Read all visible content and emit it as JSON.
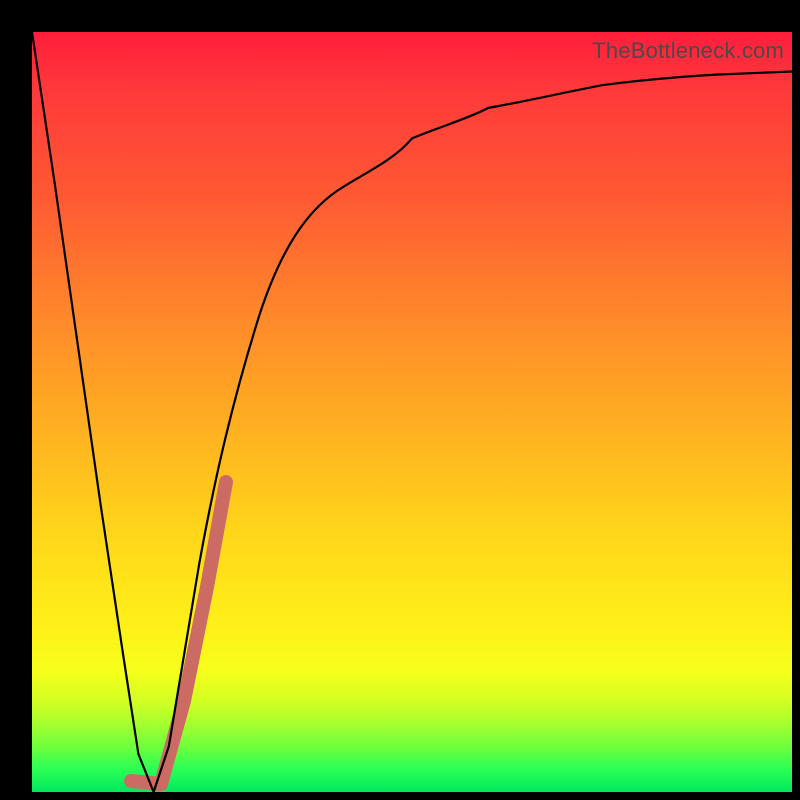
{
  "watermark": "TheBottleneck.com",
  "colors": {
    "gradient_top": "#ff1e3c",
    "gradient_mid": "#ffd61a",
    "gradient_bottom": "#00e85e",
    "curve": "#000000",
    "highlight": "#cc6b63",
    "frame": "#000000"
  },
  "chart_data": {
    "type": "line",
    "title": "",
    "xlabel": "",
    "ylabel": "",
    "xlim": [
      0,
      100
    ],
    "ylim": [
      0,
      100
    ],
    "grid": false,
    "legend": null,
    "series": [
      {
        "name": "bottleneck-curve",
        "x": [
          0,
          3,
          6,
          9,
          12,
          14,
          16,
          18,
          20,
          22,
          25,
          30,
          35,
          40,
          45,
          50,
          55,
          60,
          65,
          70,
          75,
          80,
          85,
          90,
          95,
          100
        ],
        "y": [
          100,
          80,
          59,
          38,
          18,
          5,
          0,
          6,
          18,
          30,
          46,
          63,
          73,
          79,
          83,
          86,
          88,
          90,
          91,
          92,
          93,
          93.5,
          94,
          94.3,
          94.6,
          94.8
        ]
      }
    ],
    "annotations": [
      {
        "name": "highlight-segment",
        "kind": "thick-line",
        "color": "#cc6b63",
        "points_x": [
          13,
          15.5,
          17,
          20,
          23,
          25.5
        ],
        "points_y": [
          1.5,
          0.5,
          1,
          12,
          27,
          41
        ]
      }
    ]
  }
}
